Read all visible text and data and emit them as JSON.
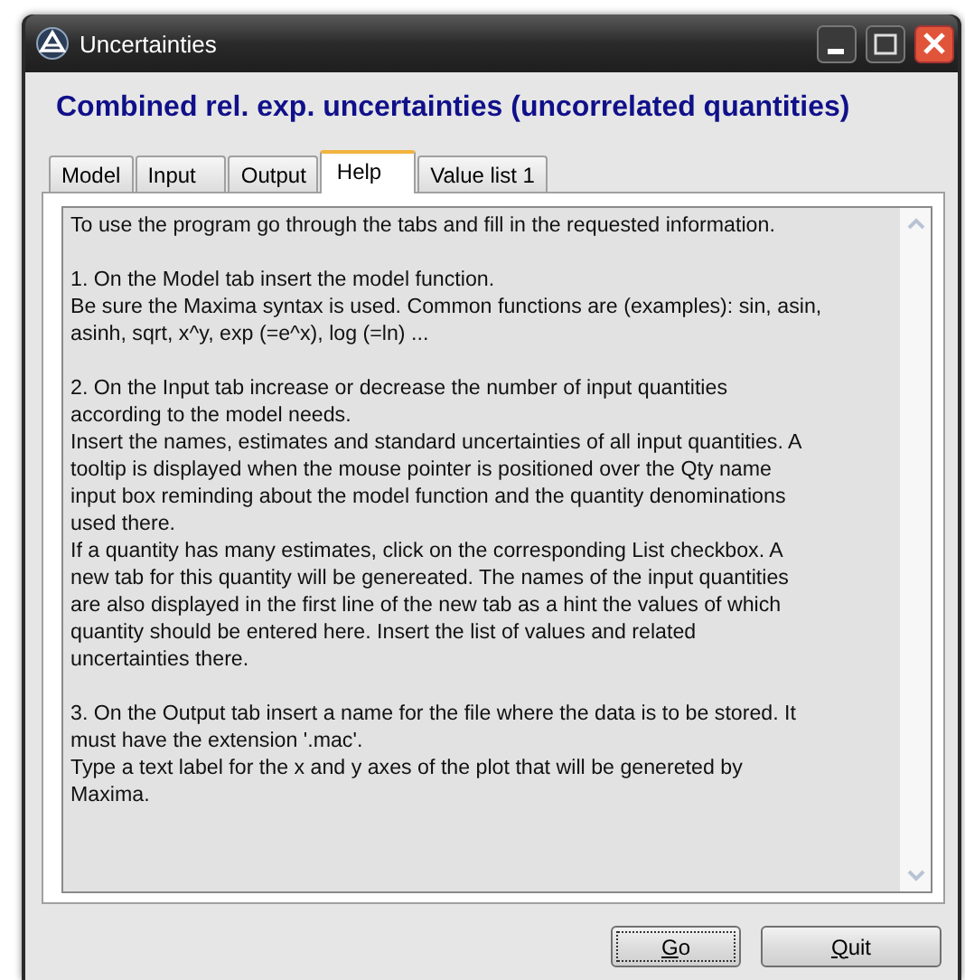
{
  "window": {
    "title": "Uncertainties"
  },
  "heading": "Combined rel. exp. uncertainties (uncorrelated quantities)",
  "tabs": [
    {
      "label": "Model",
      "selected": false
    },
    {
      "label": "Input",
      "selected": false
    },
    {
      "label": "Output",
      "selected": false
    },
    {
      "label": "Help",
      "selected": true
    },
    {
      "label": "Value list 1",
      "selected": false
    }
  ],
  "help_text": [
    [
      "To use the program go through the tabs and fill in the requested information."
    ],
    [
      "1. On the Model tab insert the model function.",
      "Be sure the Maxima syntax is used. Common functions are (examples): sin, asin,",
      "asinh, sqrt, x^y, exp (=e^x), log (=ln) ..."
    ],
    [
      "2. On the Input tab increase or decrease the number of input quantities",
      "according to the model needs.",
      "Insert the names, estimates and standard uncertainties of all input quantities. A",
      "tooltip is displayed when the mouse pointer  is positioned over the Qty name",
      "input box reminding about the model function and the quantity denominations",
      "used there.",
      "If a quantity has many estimates, click on the corresponding List checkbox. A",
      "new tab for this quantity will be genereated. The names of the input quantities",
      "are also displayed in the first line of the new tab as a hint the values of which",
      "quantity should be entered here. Insert the list of values and related",
      "uncertainties there."
    ],
    [
      "3. On the Output tab insert a name for the file where the data is to be stored. It",
      "must have the extension '.mac'.",
      "Type a text label for the x and y axes of the plot that will be genereted by",
      "Maxima."
    ]
  ],
  "buttons": [
    {
      "label": "Go",
      "first_letter_underlined": true,
      "focused": true
    },
    {
      "label": "Quit",
      "first_letter_underlined": true,
      "focused": false
    }
  ]
}
